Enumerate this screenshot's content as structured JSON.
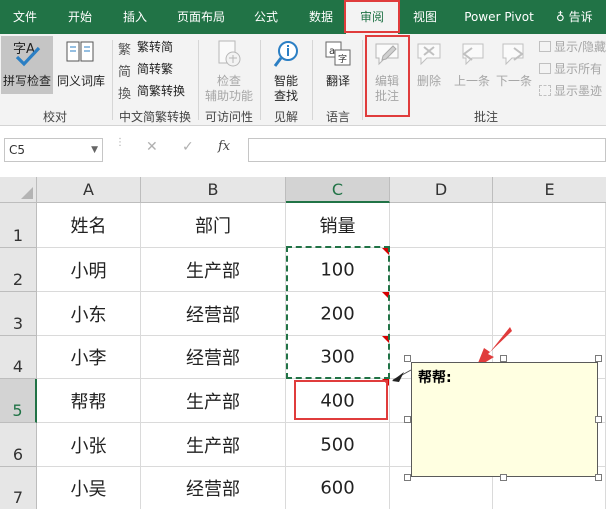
{
  "ribbon_tabs": [
    {
      "label": "文件",
      "active": false
    },
    {
      "label": "开始",
      "active": false
    },
    {
      "label": "插入",
      "active": false
    },
    {
      "label": "页面布局",
      "active": false
    },
    {
      "label": "公式",
      "active": false
    },
    {
      "label": "数据",
      "active": false
    },
    {
      "label": "审阅",
      "active": true
    },
    {
      "label": "视图",
      "active": false
    },
    {
      "label": "Power Pivot",
      "active": false
    },
    {
      "label": "告诉",
      "active": false
    }
  ],
  "ribbon": {
    "proofing": {
      "spell_check_label": "拼写检查",
      "spell_icon_text": "字A",
      "thesaurus_label": "同义词库",
      "group_label": "校对"
    },
    "chinese": {
      "to_traditional": "繁转简",
      "to_simplified": "简转繁",
      "convert": "简繁转换",
      "group_label": "中文简繁转换"
    },
    "accessibility": {
      "check_line1": "检查",
      "check_line2": "辅助功能",
      "group_label": "可访问性"
    },
    "insights": {
      "smart_line1": "智能",
      "smart_line2": "查找",
      "group_label": "见解"
    },
    "language": {
      "translate_label": "翻译",
      "group_label": "语言"
    },
    "comments": {
      "edit_line1": "编辑",
      "edit_line2": "批注",
      "delete_label": "删除",
      "prev_label": "上一条",
      "next_label": "下一条",
      "show_hide": "显示/隐藏",
      "show_all": "显示所有",
      "show_ink": "显示墨迹",
      "group_label": "批注"
    }
  },
  "formula_bar": {
    "name_box": "C5",
    "cancel_icon": "✕",
    "enter_icon": "✓",
    "fx_label": "fx",
    "value": ""
  },
  "sheet": {
    "columns": [
      "A",
      "B",
      "C",
      "D",
      "E"
    ],
    "row_numbers": [
      "1",
      "2",
      "3",
      "4",
      "5",
      "6",
      "7"
    ],
    "selected_cell": "C5",
    "rows": [
      [
        "姓名",
        "部门",
        "销量"
      ],
      [
        "小明",
        "生产部",
        "100"
      ],
      [
        "小东",
        "经营部",
        "200"
      ],
      [
        "小李",
        "经营部",
        "300"
      ],
      [
        "帮帮",
        "生产部",
        "400"
      ],
      [
        "小张",
        "生产部",
        "500"
      ],
      [
        "小吴",
        "经营部",
        "600"
      ]
    ]
  },
  "comment": {
    "author": "帮帮:"
  },
  "colors": {
    "ribbon_green": "#217346",
    "highlight_red": "#e03c3c",
    "copy_border": "#217346",
    "comment_bg": "#ffffe1"
  }
}
